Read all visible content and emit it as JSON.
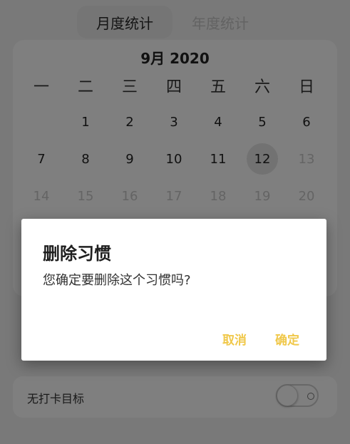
{
  "tabs": [
    {
      "label": "月度统计",
      "active": true
    },
    {
      "label": "年度统计",
      "active": false
    }
  ],
  "calendar": {
    "title": "9月 2020",
    "weekdays": [
      "一",
      "二",
      "三",
      "四",
      "五",
      "六",
      "日"
    ],
    "today": 12,
    "rows": [
      [
        null,
        "1",
        "2",
        "3",
        "4",
        "5",
        "6"
      ],
      [
        "7",
        "8",
        "9",
        "10",
        "11",
        "12",
        "13"
      ],
      [
        "14",
        "15",
        "16",
        "17",
        "18",
        "19",
        "20"
      ]
    ]
  },
  "goal": {
    "label": "无打卡目标",
    "switch_on": false
  },
  "dialog": {
    "title": "删除习惯",
    "message": "您确定要删除这个习惯吗?",
    "cancel_label": "取消",
    "confirm_label": "确定"
  },
  "colors": {
    "accent": "#f0c84a",
    "overlay": "rgba(0,0,0,0.5)"
  }
}
